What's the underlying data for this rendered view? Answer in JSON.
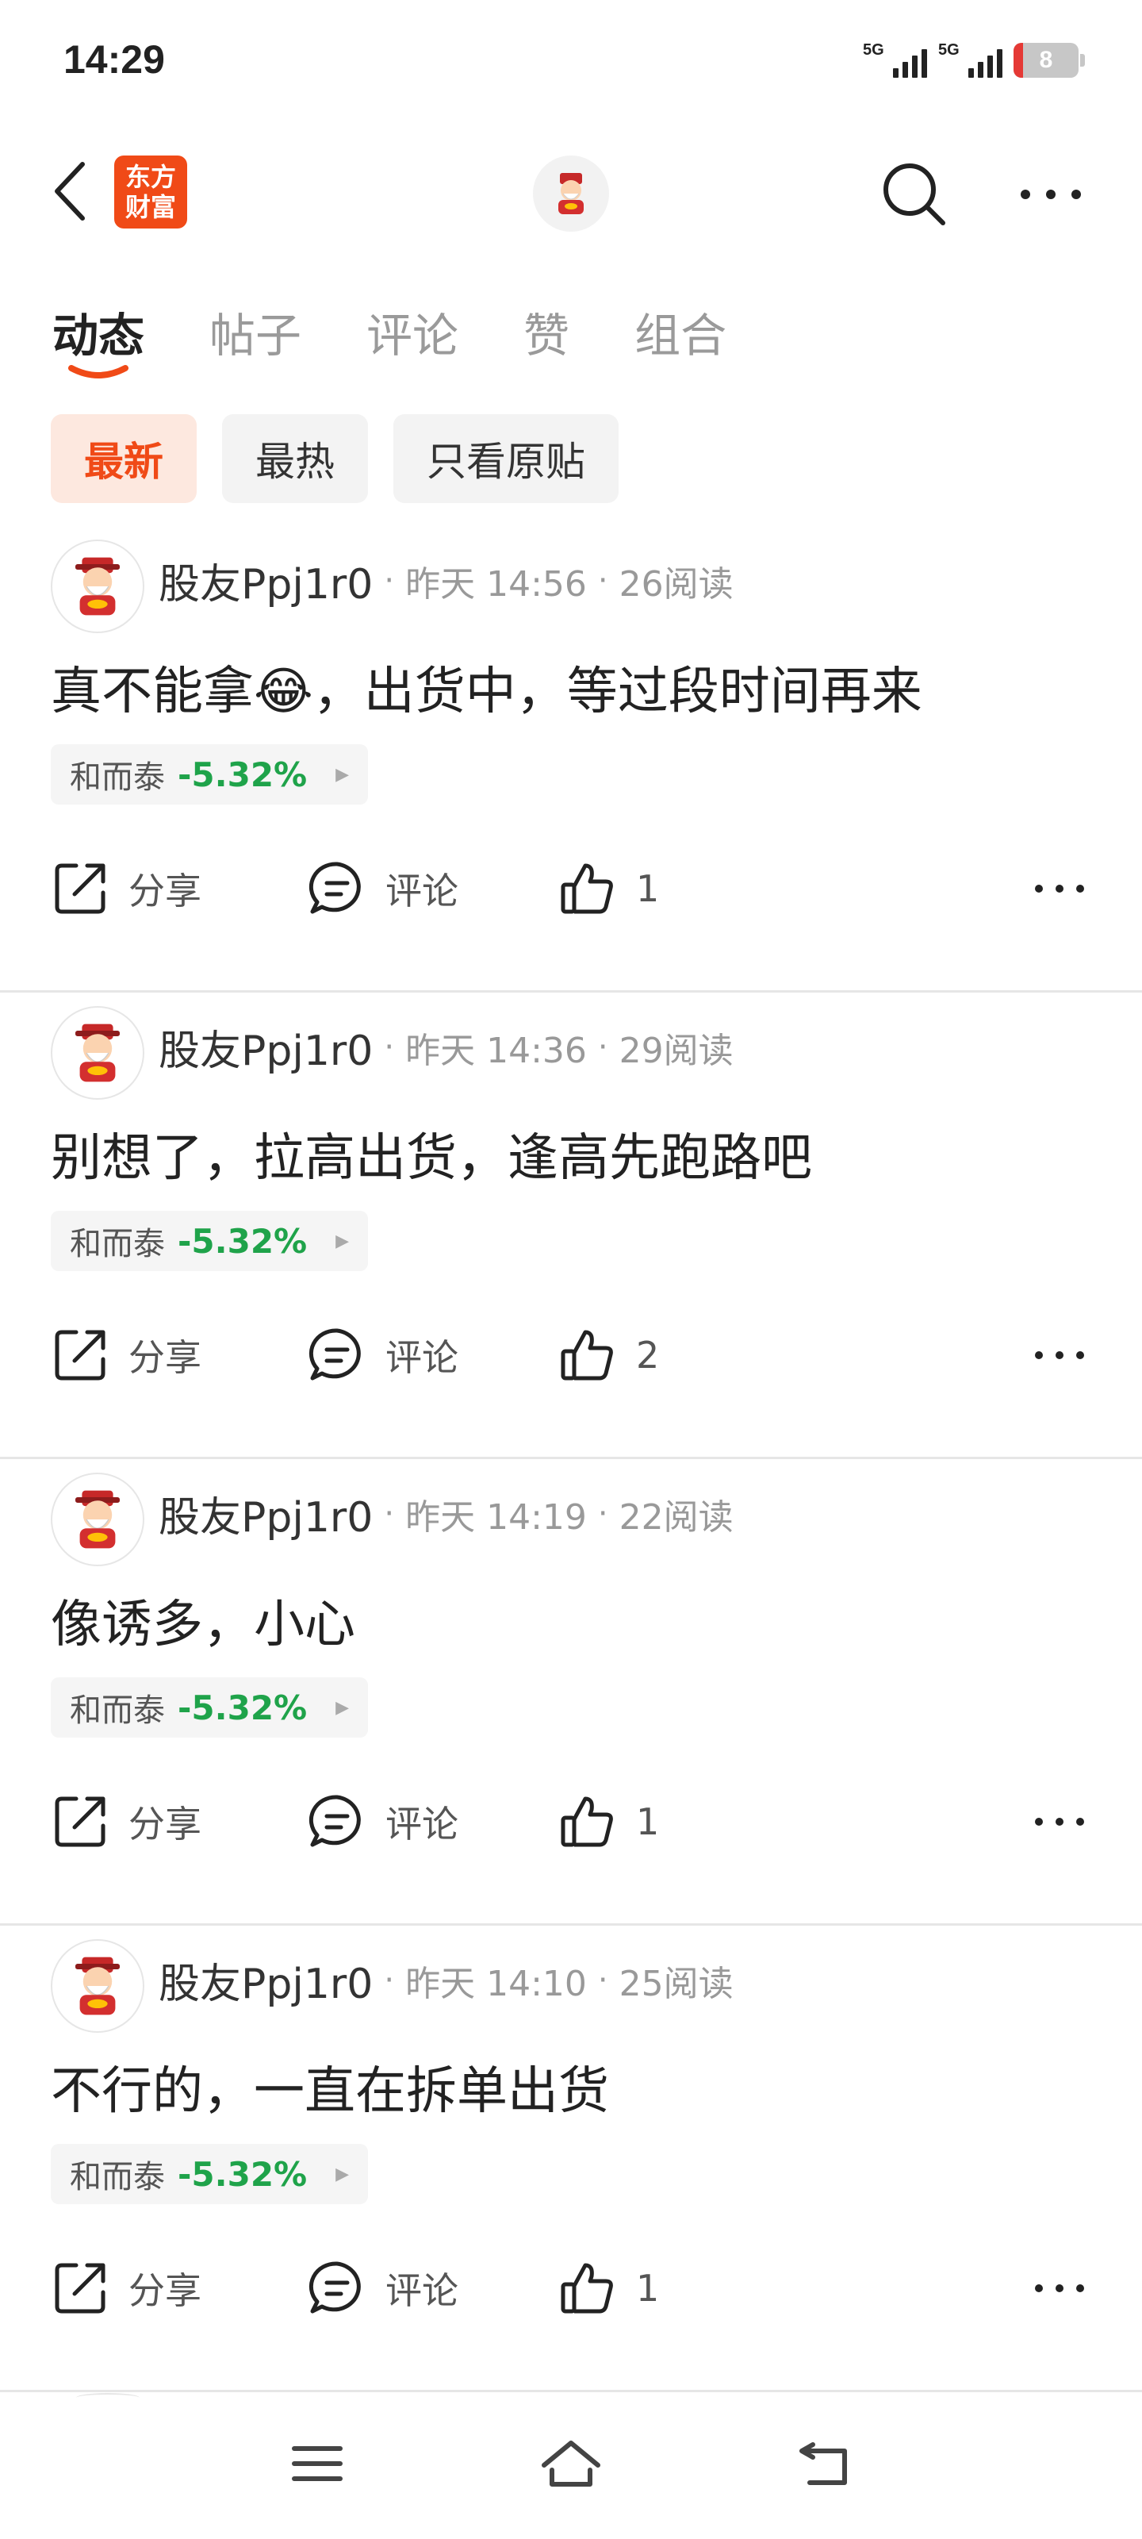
{
  "status_bar": {
    "time": "14:29",
    "network1": "5G",
    "network2": "5G",
    "battery": "8",
    "battery_color": "#e53935"
  },
  "header": {
    "logo_line1": "东方",
    "logo_line2": "财富",
    "logo_color": "#f04a17",
    "back_icon": "chevron-left-icon",
    "search_icon": "search-icon",
    "more_icon": "more-horizontal-icon"
  },
  "tabs": [
    {
      "label": "动态",
      "active": true
    },
    {
      "label": "帖子",
      "active": false
    },
    {
      "label": "评论",
      "active": false
    },
    {
      "label": "赞",
      "active": false
    },
    {
      "label": "组合",
      "active": false
    }
  ],
  "filters": [
    {
      "label": "最新",
      "active": true
    },
    {
      "label": "最热",
      "active": false
    },
    {
      "label": "只看原贴",
      "active": false
    }
  ],
  "posts": [
    {
      "author": "股友Ppj1r0",
      "time": "昨天 14:56",
      "reads": "26阅读",
      "content": "真不能拿😂，出货中，等过段时间再来",
      "stock_name": "和而泰",
      "stock_change": "-5.32%",
      "share_label": "分享",
      "comment_label": "评论",
      "likes": "1"
    },
    {
      "author": "股友Ppj1r0",
      "time": "昨天 14:36",
      "reads": "29阅读",
      "content": "别想了，拉高出货，逢高先跑路吧",
      "stock_name": "和而泰",
      "stock_change": "-5.32%",
      "share_label": "分享",
      "comment_label": "评论",
      "likes": "2"
    },
    {
      "author": "股友Ppj1r0",
      "time": "昨天 14:19",
      "reads": "22阅读",
      "content": "像诱多，小心",
      "stock_name": "和而泰",
      "stock_change": "-5.32%",
      "share_label": "分享",
      "comment_label": "评论",
      "likes": "1"
    },
    {
      "author": "股友Ppj1r0",
      "time": "昨天 14:10",
      "reads": "25阅读",
      "content": "不行的，一直在拆单出货",
      "stock_name": "和而泰",
      "stock_change": "-5.32%",
      "share_label": "分享",
      "comment_label": "评论",
      "likes": "1"
    }
  ],
  "colors": {
    "accent": "#f04a17",
    "stock_down": "#1fa34a"
  },
  "nav_icons": [
    "menu-icon",
    "home-icon",
    "back-icon"
  ]
}
